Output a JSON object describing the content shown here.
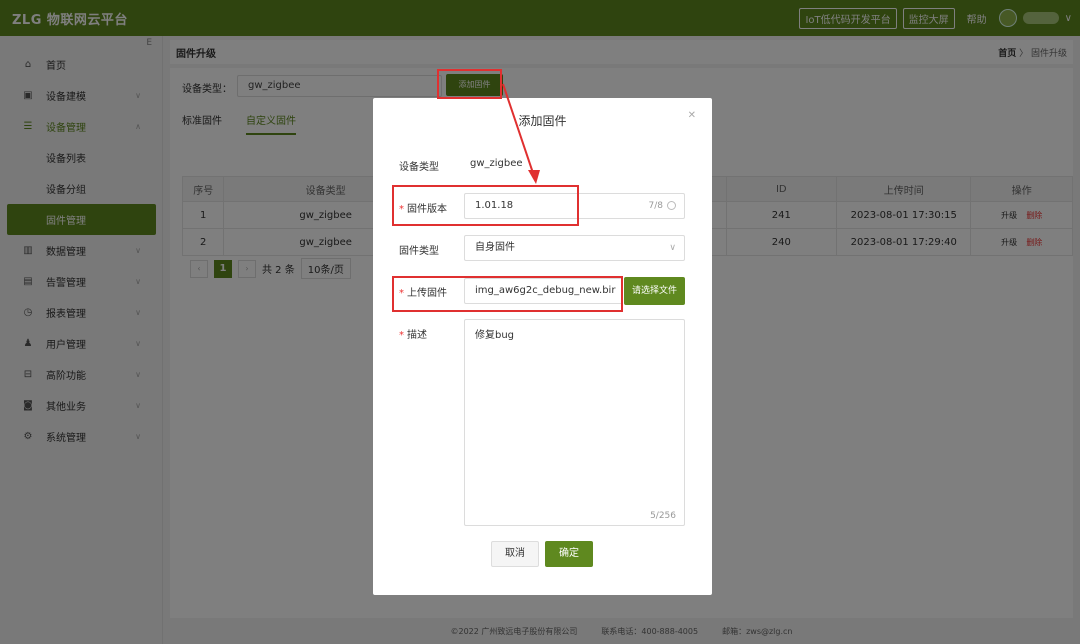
{
  "header": {
    "logo": "ZLG 物联网云平台",
    "lowcode_button": "IoT低代码开发平台",
    "bigscreen_button": "监控大屏",
    "help": "帮助",
    "collapse_icon": "E"
  },
  "sidebar": {
    "items": [
      {
        "label": "首页",
        "icon": "home-icon"
      },
      {
        "label": "设备建模",
        "icon": "model-icon"
      },
      {
        "label": "设备管理",
        "icon": "device-icon"
      },
      {
        "label": "设备列表"
      },
      {
        "label": "设备分组"
      },
      {
        "label": "固件管理"
      },
      {
        "label": "数据管理",
        "icon": "chart-icon"
      },
      {
        "label": "告警管理",
        "icon": "alarm-icon"
      },
      {
        "label": "报表管理",
        "icon": "clock-icon"
      },
      {
        "label": "用户管理",
        "icon": "user-icon"
      },
      {
        "label": "高阶功能",
        "icon": "feature-icon"
      },
      {
        "label": "其他业务",
        "icon": "other-icon"
      },
      {
        "label": "系统管理",
        "icon": "gear-icon"
      }
    ]
  },
  "page": {
    "title": "固件升级",
    "breadcrumb_home": "首页",
    "breadcrumb_sep": "〉",
    "breadcrumb_current": "固件升级"
  },
  "filter": {
    "label": "设备类型：",
    "value": "gw_zigbee",
    "add_button": "添加固件"
  },
  "tabs": [
    "标准固件",
    "自定义固件"
  ],
  "table": {
    "headers": [
      "序号",
      "设备类型",
      "ID",
      "上传时间",
      "操作"
    ],
    "rows": [
      {
        "no": "1",
        "type": "gw_zigbee",
        "id": "241",
        "time": "2023-08-01 17:30:15",
        "upgrade": "升级",
        "delete": "删除"
      },
      {
        "no": "2",
        "type": "gw_zigbee",
        "id": "240",
        "time": "2023-08-01 17:29:40",
        "upgrade": "升级",
        "delete": "删除"
      }
    ]
  },
  "pager": {
    "current": "1",
    "total": "共 2 条",
    "size": "10条/页"
  },
  "footer": {
    "copyright": "©2022 广州致远电子股份有限公司",
    "phone": "联系电话：400-888-4005",
    "email": "邮箱：zws@zlg.cn"
  },
  "dialog": {
    "title": "添加固件",
    "device_type_label": "设备类型",
    "device_type_value": "gw_zigbee",
    "version_label": "固件版本",
    "version_value": "1.01.18",
    "version_count": "7/8",
    "fw_type_label": "固件类型",
    "fw_type_value": "自身固件",
    "upload_label": "上传固件",
    "upload_value": "img_aw6g2c_debug_new.bir",
    "choose_button": "请选择文件",
    "desc_label": "描述",
    "desc_value": "修复bug",
    "desc_count": "5/256",
    "cancel_button": "取消",
    "ok_button": "确定"
  },
  "colors": {
    "brand": "#5f891f",
    "annotation": "#e03030"
  }
}
